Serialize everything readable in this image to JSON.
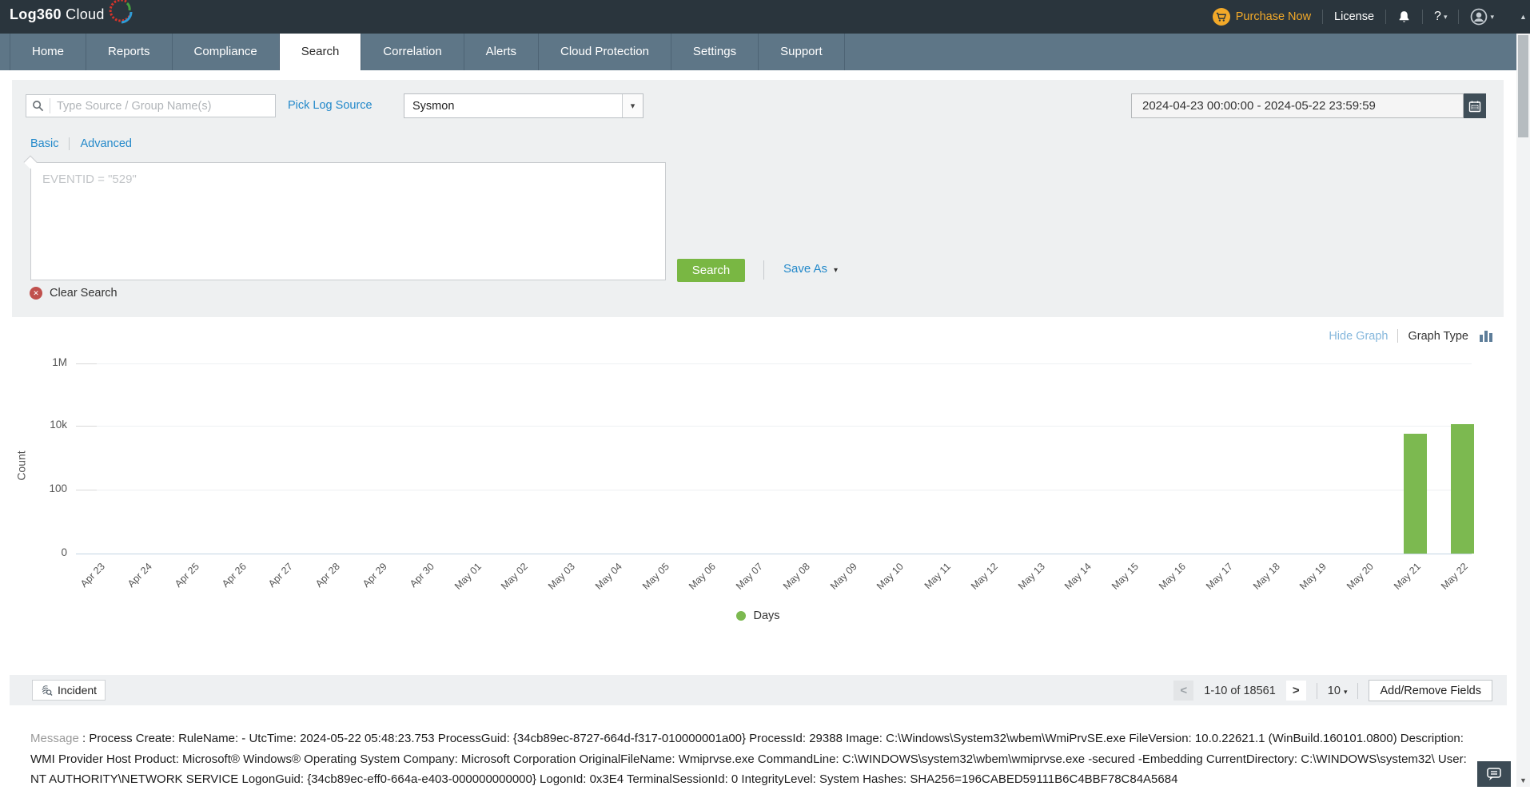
{
  "header": {
    "logo_primary": "Log360",
    "logo_secondary": "Cloud",
    "purchase_now_label": "Purchase Now",
    "license_label": "License",
    "help_label": "?"
  },
  "nav": {
    "tabs": [
      "Home",
      "Reports",
      "Compliance",
      "Search",
      "Correlation",
      "Alerts",
      "Cloud Protection",
      "Settings",
      "Support"
    ],
    "active_index": 3
  },
  "search_panel": {
    "source_placeholder": "Type Source / Group Name(s)",
    "pick_log_source_label": "Pick Log Source",
    "log_source_selected": "Sysmon",
    "date_range_value": "2024-04-23 00:00:00 - 2024-05-22 23:59:59",
    "mode_basic": "Basic",
    "mode_advanced": "Advanced",
    "query_placeholder": "EVENTID = \"529\"",
    "search_button_label": "Search",
    "save_as_label": "Save As",
    "clear_search_label": "Clear Search"
  },
  "graph_controls": {
    "hide_graph_label": "Hide Graph",
    "graph_type_label": "Graph Type"
  },
  "chart_data": {
    "type": "bar",
    "title": "",
    "xlabel": "Days",
    "ylabel": "Count",
    "scale": "log",
    "ytick_labels": [
      "1M",
      "10k",
      "100",
      "0"
    ],
    "ylim": [
      0,
      1000000
    ],
    "grid": true,
    "legend_position": "bottom-center",
    "legend_label": "Days",
    "bar_color": "#7cb950",
    "categories": [
      "Apr 23",
      "Apr 24",
      "Apr 25",
      "Apr 26",
      "Apr 27",
      "Apr 28",
      "Apr 29",
      "Apr 30",
      "May 01",
      "May 02",
      "May 03",
      "May 04",
      "May 05",
      "May 06",
      "May 07",
      "May 08",
      "May 09",
      "May 10",
      "May 11",
      "May 12",
      "May 13",
      "May 14",
      "May 15",
      "May 16",
      "May 17",
      "May 18",
      "May 19",
      "May 20",
      "May 21",
      "May 22"
    ],
    "values": [
      0,
      0,
      0,
      0,
      0,
      0,
      0,
      0,
      0,
      0,
      0,
      0,
      0,
      0,
      0,
      0,
      0,
      0,
      0,
      0,
      0,
      0,
      0,
      0,
      0,
      0,
      0,
      0,
      5600,
      11500
    ]
  },
  "toolbar": {
    "incident_label": "Incident",
    "prev_label": "<",
    "pagination_text": "1-10 of 18561",
    "next_label": ">",
    "page_size_value": "10",
    "add_remove_fields_label": "Add/Remove Fields"
  },
  "log_message": {
    "label": "Message",
    "separator": " : ",
    "text": "Process Create: RuleName: - UtcTime: 2024-05-22 05:48:23.753 ProcessGuid: {34cb89ec-8727-664d-f317-010000001a00} ProcessId: 29388 Image: C:\\Windows\\System32\\wbem\\WmiPrvSE.exe FileVersion: 10.0.22621.1 (WinBuild.160101.0800) Description: WMI Provider Host Product: Microsoft® Windows® Operating System Company: Microsoft Corporation OriginalFileName: Wmiprvse.exe CommandLine: C:\\WINDOWS\\system32\\wbem\\wmiprvse.exe -secured -Embedding CurrentDirectory: C:\\WINDOWS\\system32\\ User: NT AUTHORITY\\NETWORK SERVICE LogonGuid: {34cb89ec-eff0-664a-e403-000000000000} LogonId: 0x3E4 TerminalSessionId: 0 IntegrityLevel: System Hashes: SHA256=196CABED59111B6C4BBF78C84A5684"
  },
  "icons": {
    "up_caret": "▲",
    "down_caret": "▼",
    "small_caret": "▾",
    "close_x": "✕"
  },
  "colors": {
    "header_bg": "#2a353d",
    "nav_bg": "#5e7687",
    "panel_bg": "#eef0f1",
    "accent_green": "#79b743",
    "bar_green": "#7cb950",
    "link_blue": "#2389ca",
    "purchase_yellow": "#f2a929",
    "clear_red": "#c0504d"
  }
}
